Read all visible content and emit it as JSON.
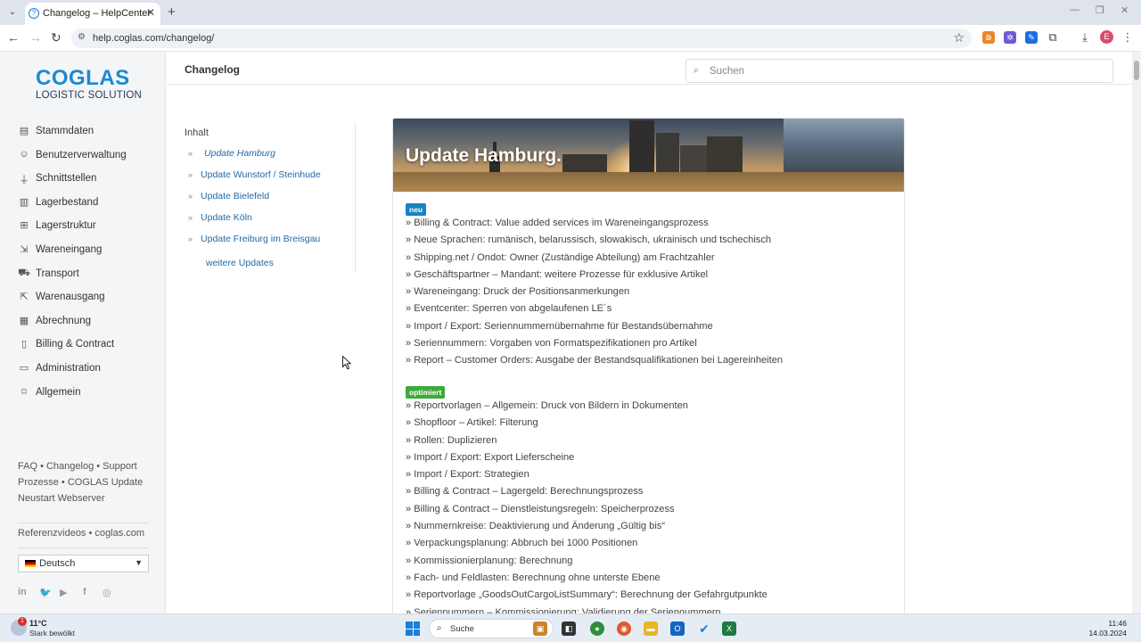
{
  "browser": {
    "tab_title": "Changelog – HelpCenter",
    "url": "help.coglas.com/changelog/",
    "profile_initial": "E"
  },
  "sidebar": {
    "logo_main": "COGLAS",
    "logo_sub": "LOGISTIC SOLUTION",
    "menu": [
      {
        "label": "Stammdaten",
        "icon": "document-icon"
      },
      {
        "label": "Benutzerverwaltung",
        "icon": "users-icon"
      },
      {
        "label": "Schnittstellen",
        "icon": "plug-icon"
      },
      {
        "label": "Lagerbestand",
        "icon": "chart-icon"
      },
      {
        "label": "Lagerstruktur",
        "icon": "structure-icon"
      },
      {
        "label": "Wareneingang",
        "icon": "inbound-icon"
      },
      {
        "label": "Transport",
        "icon": "truck-icon"
      },
      {
        "label": "Warenausgang",
        "icon": "outbound-icon"
      },
      {
        "label": "Abrechnung",
        "icon": "calculator-icon"
      },
      {
        "label": "Billing & Contract",
        "icon": "file-icon"
      },
      {
        "label": "Administration",
        "icon": "window-icon"
      },
      {
        "label": "Allgemein",
        "icon": "bookmark-icon"
      }
    ],
    "footer_links": {
      "faq": "FAQ",
      "changelog": "Changelog",
      "support": "Support",
      "prozesse": "Prozesse",
      "update": "COGLAS Update",
      "neustart": "Neustart Webserver",
      "referenzvideos": "Referenzvideos",
      "coglas": "coglas.com"
    },
    "language": "Deutsch"
  },
  "header": {
    "title": "Changelog",
    "search_placeholder": "Suchen"
  },
  "toc": {
    "title": "Inhalt",
    "items": [
      "Update Hamburg",
      "Update Wunstorf / Steinhude",
      "Update Bielefeld",
      "Update Köln",
      "Update Freiburg im Breisgau"
    ],
    "more": "weitere Updates"
  },
  "article": {
    "hero_title": "Update Hamburg.",
    "badge_new": "neu",
    "new_items": [
      "» Billing & Contract: Value added services im Wareneingangsprozess",
      "» Neue Sprachen: rumänisch, belarussisch, slowakisch, ukrainisch und tschechisch",
      "» Shipping.net / Ondot: Owner (Zuständige Abteilung) am Frachtzahler",
      "» Geschäftspartner – Mandant: weitere Prozesse für exklusive Artikel",
      "» Wareneingang: Druck der Positionsanmerkungen",
      "» Eventcenter: Sperren von abgelaufenen LE´s",
      "» Import / Export: Seriennummernübernahme für Bestandsübernahme",
      "» Seriennummern: Vorgaben von Formatspezifikationen pro Artikel",
      "» Report – Customer Orders: Ausgabe der Bestandsqualifikationen bei Lagereinheiten"
    ],
    "badge_opt": "optimiert",
    "opt_items": [
      "» Reportvorlagen – Allgemein: Druck von Bildern in Dokumenten",
      "» Shopfloor – Artikel: Filterung",
      "» Rollen: Duplizieren",
      "» Import / Export: Export Lieferscheine",
      "» Import / Export: Strategien",
      "» Billing & Contract – Lagergeld: Berechnungsprozess",
      "» Billing & Contract – Dienstleistungsregeln: Speicherprozess",
      "» Nummernkreise: Deaktivierung und Änderung „Gültig bis“",
      "» Verpackungsplanung: Abbruch bei 1000 Positionen",
      "» Kommissionierplanung: Berechnung",
      "» Fach- und Feldlasten: Berechnung ohne unterste Ebene",
      "» Reportvorlage „GoodsOutCargoListSummary“: Berechnung der Gefahrgutpunkte",
      "» Seriennummern – Kommissionierung: Validierung der Seriennummern"
    ]
  },
  "taskbar": {
    "notification_count": "1",
    "temperature": "11°C",
    "weather": "Stark bewölkt",
    "search_label": "Suche",
    "time": "11:46",
    "date": "14.03.2024"
  },
  "colors": {
    "brand_blue": "#1a8ad4",
    "link_blue": "#2368a8",
    "badge_new": "#1a82c4",
    "badge_opt": "#3eaa3b"
  }
}
